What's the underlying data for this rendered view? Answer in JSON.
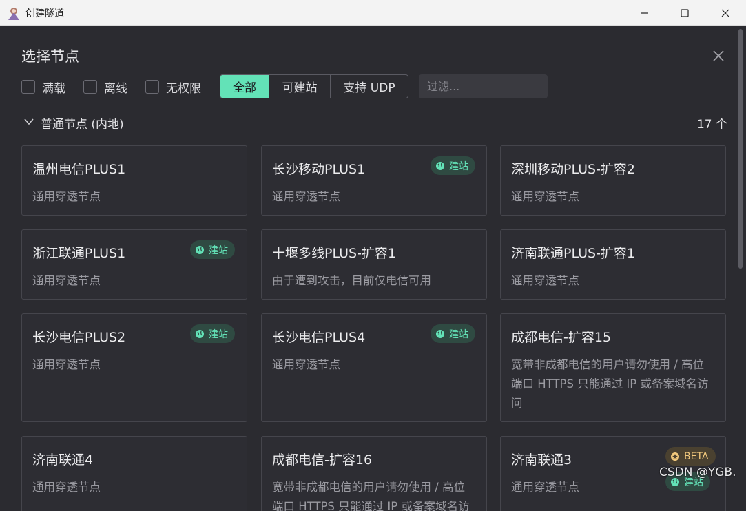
{
  "window": {
    "title": "创建隧道"
  },
  "dialog": {
    "title": "选择节点",
    "filters": [
      {
        "label": "满载"
      },
      {
        "label": "离线"
      },
      {
        "label": "无权限"
      }
    ],
    "segments": [
      {
        "label": "全部",
        "active": true
      },
      {
        "label": "可建站",
        "active": false
      },
      {
        "label": "支持 UDP",
        "active": false
      }
    ],
    "search": {
      "placeholder": "过滤...",
      "value": ""
    }
  },
  "section": {
    "title": "普通节点 (内地)",
    "count": "17 个"
  },
  "cards": [
    {
      "title": "温州电信PLUS1",
      "desc": "通用穿透节点",
      "badges": []
    },
    {
      "title": "长沙移动PLUS1",
      "desc": "通用穿透节点",
      "badges": [
        "建站"
      ]
    },
    {
      "title": "深圳移动PLUS-扩容2",
      "desc": "通用穿透节点",
      "badges": []
    },
    {
      "title": "浙江联通PLUS1",
      "desc": "通用穿透节点",
      "badges": [
        "建站"
      ]
    },
    {
      "title": "十堰多线PLUS-扩容1",
      "desc": "由于遭到攻击，目前仅电信可用",
      "badges": []
    },
    {
      "title": "济南联通PLUS-扩容1",
      "desc": "通用穿透节点",
      "badges": []
    },
    {
      "title": "长沙电信PLUS2",
      "desc": "通用穿透节点",
      "badges": [
        "建站"
      ]
    },
    {
      "title": "长沙电信PLUS4",
      "desc": "通用穿透节点",
      "badges": [
        "建站"
      ]
    },
    {
      "title": "成都电信-扩容15",
      "desc": "宽带非成都电信的用户请勿使用 / 高位端口 HTTPS 只能通过 IP 或备案域名访问",
      "badges": []
    },
    {
      "title": "济南联通4",
      "desc": "通用穿透节点",
      "badges": []
    },
    {
      "title": "成都电信-扩容16",
      "desc": "宽带非成都电信的用户请勿使用 / 高位端口 HTTPS 只能通过 IP 或备案域名访问",
      "badges": []
    },
    {
      "title": "济南联通3",
      "desc": "通用穿透节点",
      "badges": [
        "BETA",
        "建站"
      ]
    }
  ],
  "watermark": "CSDN @YGB.",
  "colors": {
    "accent": "#63e2b7",
    "beta": "#f2c97d"
  }
}
